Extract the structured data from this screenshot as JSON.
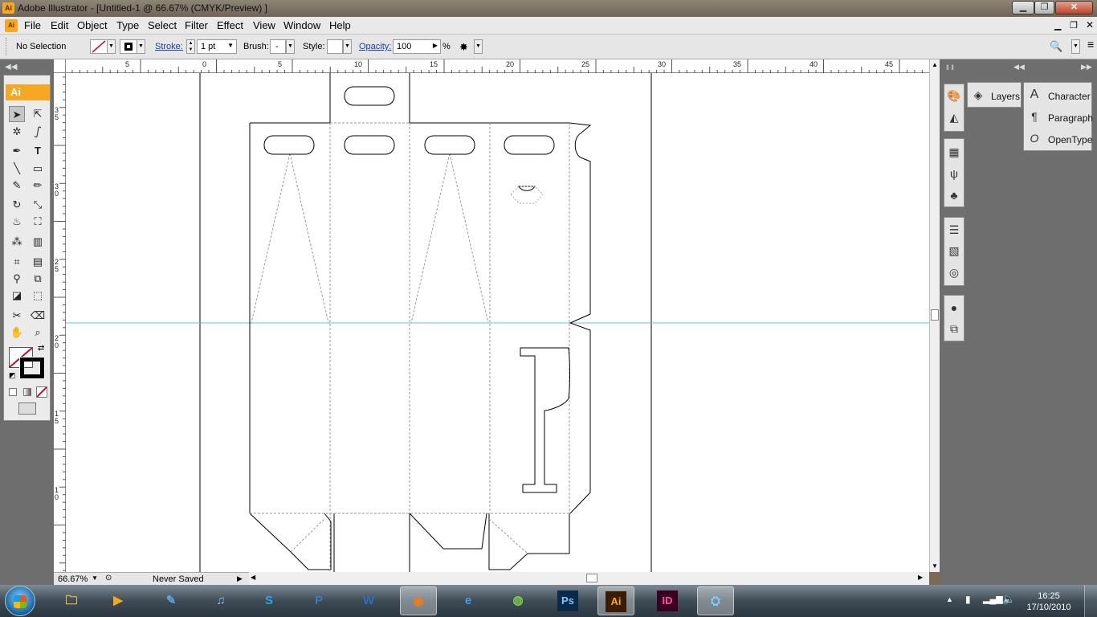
{
  "window": {
    "title": "Adobe Illustrator - [Untitled-1 @ 66.67% (CMYK/Preview) ]",
    "app_icon": "Ai"
  },
  "menus": [
    "File",
    "Edit",
    "Object",
    "Type",
    "Select",
    "Filter",
    "Effect",
    "View",
    "Window",
    "Help"
  ],
  "control": {
    "selection": "No Selection",
    "stroke_label": "Stroke:",
    "stroke_weight": "1 pt",
    "brush_label": "Brush:",
    "brush_value": "-",
    "style_label": "Style:",
    "opacity_label": "Opacity:",
    "opacity_value": "100",
    "percent": "%"
  },
  "toolbox_header": "Ai",
  "ruler_h": [
    "5",
    "0",
    "5",
    "10",
    "15",
    "20",
    "25",
    "30",
    "35",
    "40",
    "45"
  ],
  "ruler_v": [
    "3\n5",
    "3\n0",
    "2\n5",
    "2\n0",
    "1\n5",
    "1\n0"
  ],
  "status": {
    "zoom": "66.67%",
    "save_state": "Never Saved"
  },
  "panels": {
    "layers": "Layers",
    "character": "Character",
    "paragraph": "Paragraph",
    "opentype": "OpenType"
  },
  "taskbar": {
    "apps": [
      "Start",
      "Explorer",
      "Media Player",
      "Paint",
      "iTunes",
      "Skype",
      "Publisher",
      "Word",
      "Firefox",
      "Internet Explorer",
      "Spotify",
      "Photoshop",
      "Illustrator",
      "InDesign",
      "Network"
    ],
    "ps_label": "Ps",
    "ai_label": "Ai",
    "id_label": "ID",
    "time": "16:25",
    "date": "17/10/2010"
  }
}
